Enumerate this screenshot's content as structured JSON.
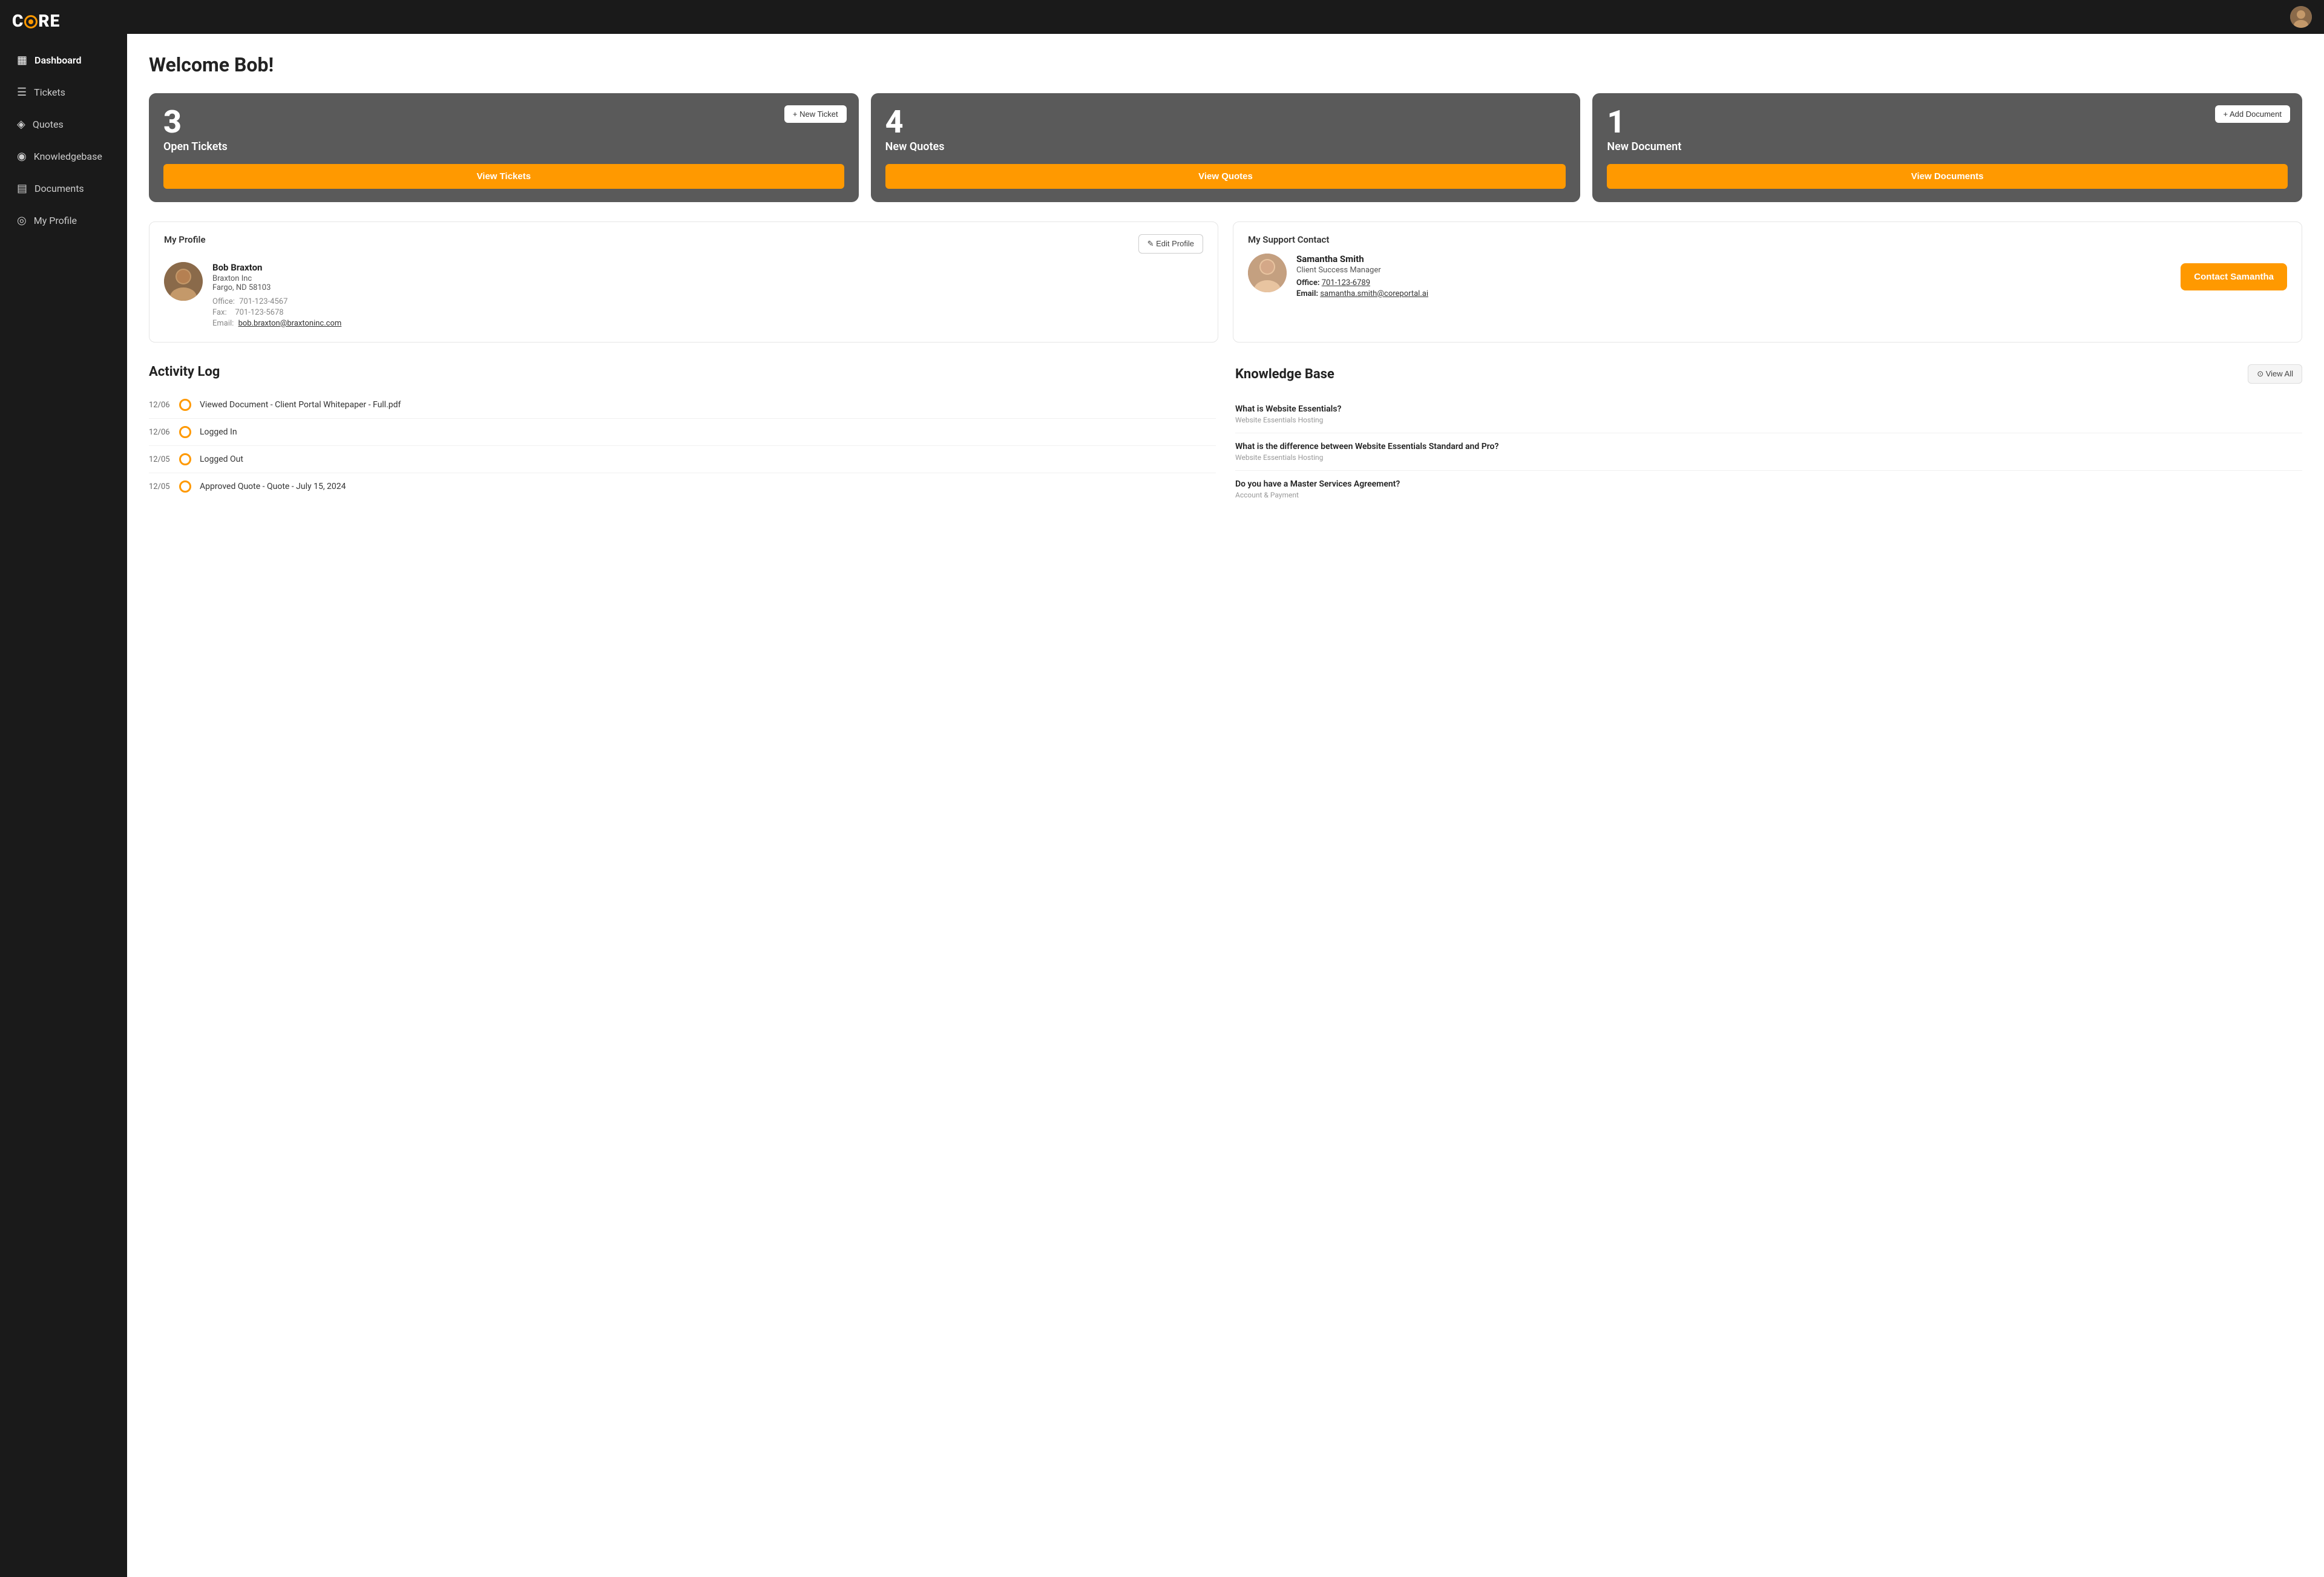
{
  "logo": {
    "text_c": "C",
    "text_re": "RE"
  },
  "sidebar": {
    "items": [
      {
        "id": "dashboard",
        "label": "Dashboard",
        "icon": "▦",
        "active": true
      },
      {
        "id": "tickets",
        "label": "Tickets",
        "icon": "☰"
      },
      {
        "id": "quotes",
        "label": "Quotes",
        "icon": "◎"
      },
      {
        "id": "knowledgebase",
        "label": "Knowledgebase",
        "icon": "◉"
      },
      {
        "id": "documents",
        "label": "Documents",
        "icon": "▤"
      },
      {
        "id": "myprofile",
        "label": "My Profile",
        "icon": "◎"
      }
    ]
  },
  "page": {
    "title": "Welcome Bob!"
  },
  "cards": [
    {
      "number": "3",
      "label": "Open Tickets",
      "action_label": "+ New Ticket",
      "view_label": "View Tickets"
    },
    {
      "number": "4",
      "label": "New Quotes",
      "action_label": null,
      "view_label": "View Quotes"
    },
    {
      "number": "1",
      "label": "New Document",
      "action_label": "+ Add Document",
      "view_label": "View Documents"
    }
  ],
  "profile": {
    "section_title": "My Profile",
    "edit_label": "✎ Edit Profile",
    "name": "Bob Braxton",
    "company": "Braxton Inc",
    "location": "Fargo, ND 58103",
    "office_label": "Office:",
    "office": "701-123-4567",
    "fax_label": "Fax:",
    "fax": "701-123-5678",
    "email_label": "Email:",
    "email": "bob.braxton@braxtoninc.com"
  },
  "support": {
    "section_title": "My Support Contact",
    "name": "Samantha Smith",
    "role": "Client Success Manager",
    "office_label": "Office:",
    "office": "701-123-6789",
    "email_label": "Email:",
    "email": "samantha.smith@coreportal.ai",
    "contact_btn": "Contact Samantha"
  },
  "activity": {
    "heading": "Activity Log",
    "items": [
      {
        "date": "12/06",
        "text": "Viewed Document - Client Portal Whitepaper - Full.pdf"
      },
      {
        "date": "12/06",
        "text": "Logged In"
      },
      {
        "date": "12/05",
        "text": "Logged Out"
      },
      {
        "date": "12/05",
        "text": "Approved Quote - Quote - July 15, 2024"
      }
    ]
  },
  "knowledgebase": {
    "heading": "Knowledge Base",
    "view_all_label": "⊙ View All",
    "items": [
      {
        "question": "What is Website Essentials?",
        "category": "Website Essentials Hosting"
      },
      {
        "question": "What is the difference between Website Essentials Standard and Pro?",
        "category": "Website Essentials Hosting"
      },
      {
        "question": "Do you have a Master Services Agreement?",
        "category": "Account & Payment"
      }
    ]
  }
}
